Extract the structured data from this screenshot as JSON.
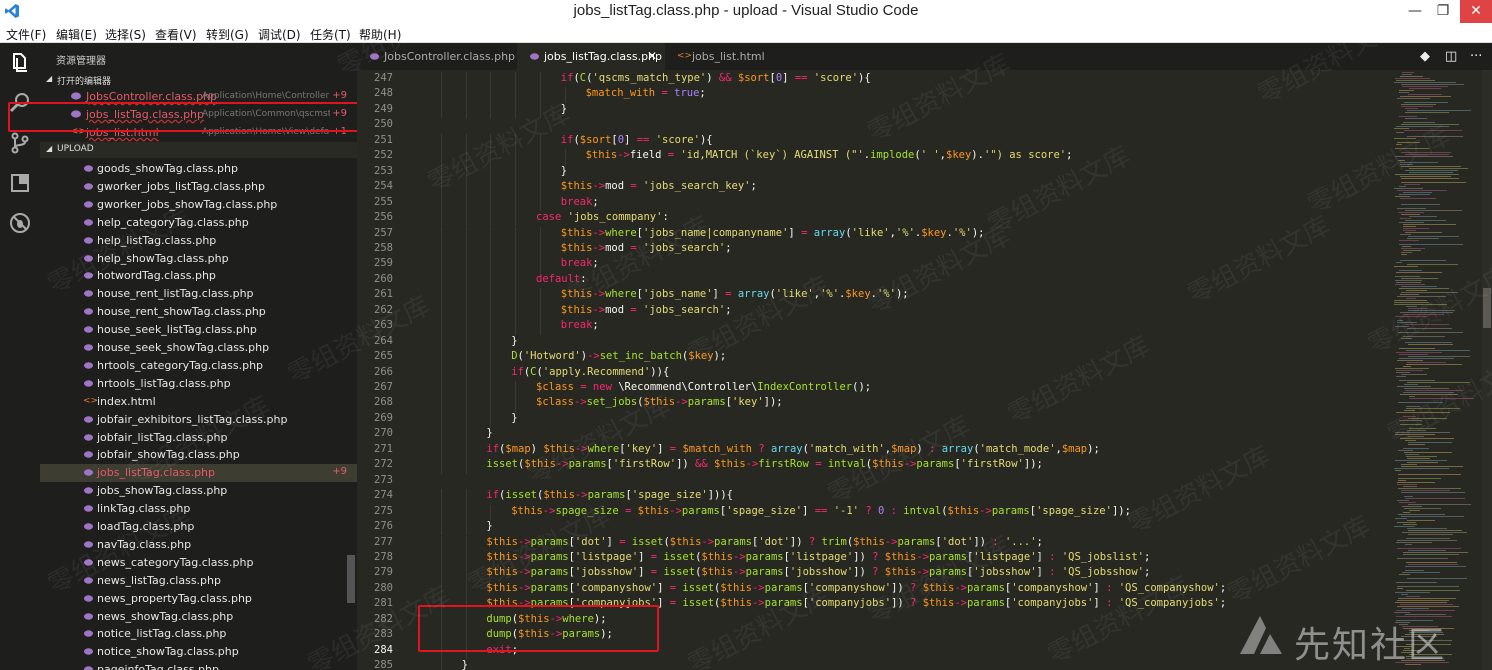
{
  "window": {
    "title": "jobs_listTag.class.php - upload - Visual Studio Code",
    "min_symbol": "—",
    "max_symbol": "❐",
    "close_symbol": "✕"
  },
  "menu": [
    "文件(F)",
    "编辑(E)",
    "选择(S)",
    "查看(V)",
    "转到(G)",
    "调试(D)",
    "任务(T)",
    "帮助(H)"
  ],
  "activity_icons": [
    "files-icon",
    "search-icon",
    "source-control-icon",
    "extensions-icon",
    "debug-icon"
  ],
  "sidebar": {
    "title": "资源管理器",
    "open_editors_label": "打开的编辑器",
    "open_editors": [
      {
        "name": "JobsController.class.php",
        "path": "Application\\Home\\Controller",
        "badge": "+9"
      },
      {
        "name": "jobs_listTag.class.php",
        "path": "Application\\Common\\qscmstag...",
        "badge": "+9"
      },
      {
        "name": "jobs_list.html",
        "path": "Application\\Home\\View\\default\\Jobs",
        "badge": "+1"
      }
    ],
    "folder_label": "UPLOAD",
    "files": [
      {
        "name": "goods_showTag.class.php",
        "type": "php"
      },
      {
        "name": "gworker_jobs_listTag.class.php",
        "type": "php"
      },
      {
        "name": "gworker_jobs_showTag.class.php",
        "type": "php"
      },
      {
        "name": "help_categoryTag.class.php",
        "type": "php"
      },
      {
        "name": "help_listTag.class.php",
        "type": "php"
      },
      {
        "name": "help_showTag.class.php",
        "type": "php"
      },
      {
        "name": "hotwordTag.class.php",
        "type": "php"
      },
      {
        "name": "house_rent_listTag.class.php",
        "type": "php"
      },
      {
        "name": "house_rent_showTag.class.php",
        "type": "php"
      },
      {
        "name": "house_seek_listTag.class.php",
        "type": "php"
      },
      {
        "name": "house_seek_showTag.class.php",
        "type": "php"
      },
      {
        "name": "hrtools_categoryTag.class.php",
        "type": "php"
      },
      {
        "name": "hrtools_listTag.class.php",
        "type": "php"
      },
      {
        "name": "index.html",
        "type": "html"
      },
      {
        "name": "jobfair_exhibitors_listTag.class.php",
        "type": "php"
      },
      {
        "name": "jobfair_listTag.class.php",
        "type": "php"
      },
      {
        "name": "jobfair_showTag.class.php",
        "type": "php"
      },
      {
        "name": "jobs_listTag.class.php",
        "type": "php",
        "active": true,
        "badge": "+9"
      },
      {
        "name": "jobs_showTag.class.php",
        "type": "php"
      },
      {
        "name": "linkTag.class.php",
        "type": "php"
      },
      {
        "name": "loadTag.class.php",
        "type": "php"
      },
      {
        "name": "navTag.class.php",
        "type": "php"
      },
      {
        "name": "news_categoryTag.class.php",
        "type": "php"
      },
      {
        "name": "news_listTag.class.php",
        "type": "php"
      },
      {
        "name": "news_propertyTag.class.php",
        "type": "php"
      },
      {
        "name": "news_showTag.class.php",
        "type": "php"
      },
      {
        "name": "notice_listTag.class.php",
        "type": "php"
      },
      {
        "name": "notice_showTag.class.php",
        "type": "php"
      },
      {
        "name": "pageinfoTag.class.php",
        "type": "php"
      }
    ]
  },
  "tabs": [
    {
      "label": "JobsController.class.php",
      "type": "php"
    },
    {
      "label": "jobs_listTag.class.php",
      "type": "php",
      "active": true,
      "close": "✕"
    },
    {
      "label": "jobs_list.html",
      "type": "html"
    }
  ],
  "tab_tools": [
    "◆",
    "◫",
    "···"
  ],
  "editor": {
    "lines": [
      {
        "n": "247",
        "indent": 6,
        "html": "<span class=\"k\">if</span>(<span class=\"f\">C</span>(<span class=\"s\">'qscms_match_type'</span>) <span class=\"k\">&amp;&amp;</span> <span class=\"v\">$sort</span>[<span class=\"c\">0</span>] <span class=\"k\">==</span> <span class=\"s\">'score'</span>){"
      },
      {
        "n": "248",
        "indent": 7,
        "html": "<span class=\"v\">$match_with</span> <span class=\"k\">=</span> <span class=\"c\">true</span>;"
      },
      {
        "n": "249",
        "indent": 6,
        "html": "}"
      },
      {
        "n": "250",
        "indent": 0,
        "html": ""
      },
      {
        "n": "251",
        "indent": 6,
        "html": "<span class=\"k\">if</span>(<span class=\"v\">$sort</span>[<span class=\"c\">0</span>] <span class=\"k\">==</span> <span class=\"s\">'score'</span>){"
      },
      {
        "n": "252",
        "indent": 7,
        "html": "<span class=\"v\">$this</span><span class=\"k\">-&gt;</span>field <span class=\"k\">=</span> <span class=\"s\">'id,MATCH (`key`) AGAINST (\"'</span>.<span class=\"f\">implode</span>(<span class=\"s\">' '</span>,<span class=\"v\">$key</span>).<span class=\"s\">'\") as score'</span>;"
      },
      {
        "n": "253",
        "indent": 6,
        "html": "}"
      },
      {
        "n": "254",
        "indent": 6,
        "html": "<span class=\"v\">$this</span><span class=\"k\">-&gt;</span>mod <span class=\"k\">=</span> <span class=\"s\">'jobs_search_key'</span>;"
      },
      {
        "n": "255",
        "indent": 6,
        "html": "<span class=\"k\">break</span>;"
      },
      {
        "n": "256",
        "indent": 5,
        "html": "<span class=\"k\">case</span> <span class=\"s\">'jobs_commpany'</span>:"
      },
      {
        "n": "257",
        "indent": 6,
        "html": "<span class=\"v\">$this</span><span class=\"k\">-&gt;</span><span class=\"f\">where</span>[<span class=\"s\">'jobs_name|companyname'</span>] <span class=\"k\">=</span> <span class=\"vt\">array</span>(<span class=\"s\">'like'</span>,<span class=\"s\">'%'</span>.<span class=\"v\">$key</span>.<span class=\"s\">'%'</span>);"
      },
      {
        "n": "258",
        "indent": 6,
        "html": "<span class=\"v\">$this</span><span class=\"k\">-&gt;</span>mod <span class=\"k\">=</span> <span class=\"s\">'jobs_search'</span>;"
      },
      {
        "n": "259",
        "indent": 6,
        "html": "<span class=\"k\">break</span>;"
      },
      {
        "n": "260",
        "indent": 5,
        "html": "<span class=\"k\">default</span>:"
      },
      {
        "n": "261",
        "indent": 6,
        "html": "<span class=\"v\">$this</span><span class=\"k\">-&gt;</span><span class=\"f\">where</span>[<span class=\"s\">'jobs_name'</span>] <span class=\"k\">=</span> <span class=\"vt\">array</span>(<span class=\"s\">'like'</span>,<span class=\"s\">'%'</span>.<span class=\"v\">$key</span>.<span class=\"s\">'%'</span>);"
      },
      {
        "n": "262",
        "indent": 6,
        "html": "<span class=\"v\">$this</span><span class=\"k\">-&gt;</span>mod <span class=\"k\">=</span> <span class=\"s\">'jobs_search'</span>;"
      },
      {
        "n": "263",
        "indent": 6,
        "html": "<span class=\"k\">break</span>;"
      },
      {
        "n": "264",
        "indent": 4,
        "html": "}"
      },
      {
        "n": "265",
        "indent": 4,
        "html": "<span class=\"f\">D</span>(<span class=\"s\">'Hotword'</span>)<span class=\"k\">-&gt;</span><span class=\"f\">set_inc_batch</span>(<span class=\"v\">$key</span>);"
      },
      {
        "n": "266",
        "indent": 4,
        "html": "<span class=\"k\">if</span>(<span class=\"f\">C</span>(<span class=\"s\">'apply.Recommend'</span>)){"
      },
      {
        "n": "267",
        "indent": 5,
        "html": "<span class=\"v\">$class</span> <span class=\"k\">=</span> <span class=\"k\">new</span> \\Recommend\\Controller\\<span class=\"f\">IndexController</span>();"
      },
      {
        "n": "268",
        "indent": 5,
        "html": "<span class=\"v\">$class</span><span class=\"k\">-&gt;</span><span class=\"f\">set_jobs</span>(<span class=\"v\">$this</span><span class=\"k\">-&gt;</span><span class=\"f\">params</span>[<span class=\"s\">'key'</span>]);"
      },
      {
        "n": "269",
        "indent": 4,
        "html": "}"
      },
      {
        "n": "270",
        "indent": 3,
        "html": "}"
      },
      {
        "n": "271",
        "indent": 3,
        "html": "<span class=\"k\">if</span>(<span class=\"v\">$map</span>) <span class=\"v\">$this</span><span class=\"k\">-&gt;</span><span class=\"f\">where</span>[<span class=\"s\">'key'</span>] <span class=\"k\">=</span> <span class=\"v\">$match_with</span> <span class=\"k\">?</span> <span class=\"vt\">array</span>(<span class=\"s\">'match_with'</span>,<span class=\"v\">$map</span>) <span class=\"k\">:</span> <span class=\"vt\">array</span>(<span class=\"s\">'match_mode'</span>,<span class=\"v\">$map</span>);"
      },
      {
        "n": "272",
        "indent": 3,
        "html": "<span class=\"f\">isset</span>(<span class=\"v\">$this</span><span class=\"k\">-&gt;</span><span class=\"f\">params</span>[<span class=\"s\">'firstRow'</span>]) <span class=\"k\">&amp;&amp;</span> <span class=\"v\">$this</span><span class=\"k\">-&gt;</span><span class=\"f\">firstRow</span> <span class=\"k\">=</span> <span class=\"f\">intval</span>(<span class=\"v\">$this</span><span class=\"k\">-&gt;</span><span class=\"f\">params</span>[<span class=\"s\">'firstRow'</span>]);"
      },
      {
        "n": "273",
        "indent": 0,
        "html": ""
      },
      {
        "n": "274",
        "indent": 3,
        "html": "<span class=\"k\">if</span>(<span class=\"f\">isset</span>(<span class=\"v\">$this</span><span class=\"k\">-&gt;</span><span class=\"f\">params</span>[<span class=\"s\">'spage_size'</span>])){"
      },
      {
        "n": "275",
        "indent": 4,
        "html": "<span class=\"v\">$this</span><span class=\"k\">-&gt;</span><span class=\"f\">spage_size</span> <span class=\"k\">=</span> <span class=\"v\">$this</span><span class=\"k\">-&gt;</span><span class=\"f\">params</span>[<span class=\"s\">'spage_size'</span>] <span class=\"k\">==</span> <span class=\"s\">'-1'</span> <span class=\"k\">?</span> <span class=\"c\">0</span> <span class=\"k\">:</span> <span class=\"f\">intval</span>(<span class=\"v\">$this</span><span class=\"k\">-&gt;</span><span class=\"f\">params</span>[<span class=\"s\">'spage_size'</span>]);"
      },
      {
        "n": "276",
        "indent": 3,
        "html": "}"
      },
      {
        "n": "277",
        "indent": 3,
        "html": "<span class=\"v\">$this</span><span class=\"k\">-&gt;</span><span class=\"f\">params</span>[<span class=\"s\">'dot'</span>] <span class=\"k\">=</span> <span class=\"f\">isset</span>(<span class=\"v\">$this</span><span class=\"k\">-&gt;</span><span class=\"f\">params</span>[<span class=\"s\">'dot'</span>]) <span class=\"k\">?</span> <span class=\"f\">trim</span>(<span class=\"v\">$this</span><span class=\"k\">-&gt;</span><span class=\"f\">params</span>[<span class=\"s\">'dot'</span>]) <span class=\"k\">:</span> <span class=\"s\">'...'</span>;"
      },
      {
        "n": "278",
        "indent": 3,
        "html": "<span class=\"v\">$this</span><span class=\"k\">-&gt;</span><span class=\"f\">params</span>[<span class=\"s\">'listpage'</span>] <span class=\"k\">=</span> <span class=\"f\">isset</span>(<span class=\"v\">$this</span><span class=\"k\">-&gt;</span><span class=\"f\">params</span>[<span class=\"s\">'listpage'</span>]) <span class=\"k\">?</span> <span class=\"v\">$this</span><span class=\"k\">-&gt;</span><span class=\"f\">params</span>[<span class=\"s\">'listpage'</span>] <span class=\"k\">:</span> <span class=\"s\">'QS_jobslist'</span>;"
      },
      {
        "n": "279",
        "indent": 3,
        "html": "<span class=\"v\">$this</span><span class=\"k\">-&gt;</span><span class=\"f\">params</span>[<span class=\"s\">'jobsshow'</span>] <span class=\"k\">=</span> <span class=\"f\">isset</span>(<span class=\"v\">$this</span><span class=\"k\">-&gt;</span><span class=\"f\">params</span>[<span class=\"s\">'jobsshow'</span>]) <span class=\"k\">?</span> <span class=\"v\">$this</span><span class=\"k\">-&gt;</span><span class=\"f\">params</span>[<span class=\"s\">'jobsshow'</span>] <span class=\"k\">:</span> <span class=\"s\">'QS_jobsshow'</span>;"
      },
      {
        "n": "280",
        "indent": 3,
        "html": "<span class=\"v\">$this</span><span class=\"k\">-&gt;</span><span class=\"f\">params</span>[<span class=\"s\">'companyshow'</span>] <span class=\"k\">=</span> <span class=\"f\">isset</span>(<span class=\"v\">$this</span><span class=\"k\">-&gt;</span><span class=\"f\">params</span>[<span class=\"s\">'companyshow'</span>]) <span class=\"k\">?</span> <span class=\"v\">$this</span><span class=\"k\">-&gt;</span><span class=\"f\">params</span>[<span class=\"s\">'companyshow'</span>] <span class=\"k\">:</span> <span class=\"s\">'QS_companyshow'</span>;"
      },
      {
        "n": "281",
        "indent": 3,
        "html": "<span class=\"v\">$this</span><span class=\"k\">-&gt;</span><span class=\"f\">params</span>[<span class=\"s\">'companyjobs'</span>] <span class=\"k\">=</span> <span class=\"f\">isset</span>(<span class=\"v\">$this</span><span class=\"k\">-&gt;</span><span class=\"f\">params</span>[<span class=\"s\">'companyjobs'</span>]) <span class=\"k\">?</span> <span class=\"v\">$this</span><span class=\"k\">-&gt;</span><span class=\"f\">params</span>[<span class=\"s\">'companyjobs'</span>] <span class=\"k\">:</span> <span class=\"s\">'QS_companyjobs'</span>;"
      },
      {
        "n": "282",
        "indent": 3,
        "html": "<span class=\"f\">dump</span>(<span class=\"v\">$this</span><span class=\"k\">-&gt;</span><span class=\"f\">where</span>);"
      },
      {
        "n": "283",
        "indent": 3,
        "html": "<span class=\"f\">dump</span>(<span class=\"v\">$this</span><span class=\"k\">-&gt;</span><span class=\"f\">params</span>);"
      },
      {
        "n": "284",
        "indent": 3,
        "html": "<span class=\"k\">exit</span>;",
        "current": true
      },
      {
        "n": "285",
        "indent": 2,
        "html": "}"
      }
    ]
  },
  "watermark": {
    "text": "零组资料文库",
    "logo_text": "先知社区"
  }
}
